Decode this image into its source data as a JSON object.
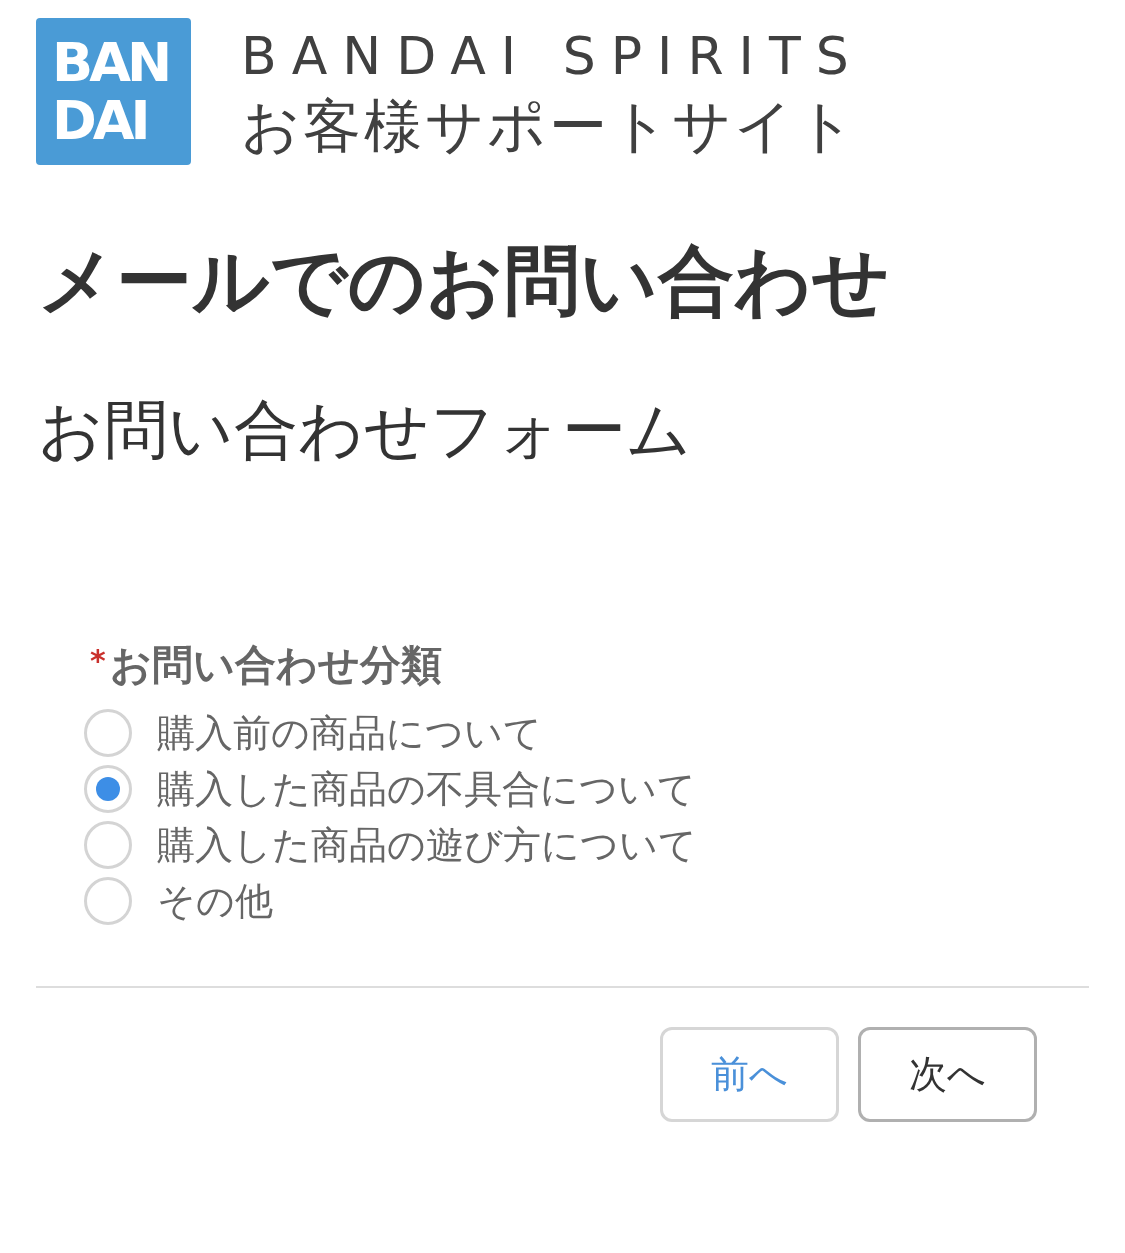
{
  "header": {
    "logo": {
      "lines": [
        "BAN",
        "DAI"
      ]
    },
    "brand": "BANDAI SPIRITS",
    "site_name": "お客様サポートサイト"
  },
  "page_title": "メールでのお問い合わせ",
  "form_title": "お問い合わせフォーム",
  "field": {
    "required_mark": "*",
    "label": "お問い合わせ分類",
    "options": [
      {
        "label": "購入前の商品について",
        "selected": false
      },
      {
        "label": "購入した商品の不具合について",
        "selected": true
      },
      {
        "label": "購入した商品の遊び方について",
        "selected": false
      },
      {
        "label": "その他",
        "selected": false
      }
    ]
  },
  "buttons": [
    {
      "label": "前へ",
      "kind": "link"
    },
    {
      "label": "次へ",
      "kind": "neutral"
    }
  ]
}
